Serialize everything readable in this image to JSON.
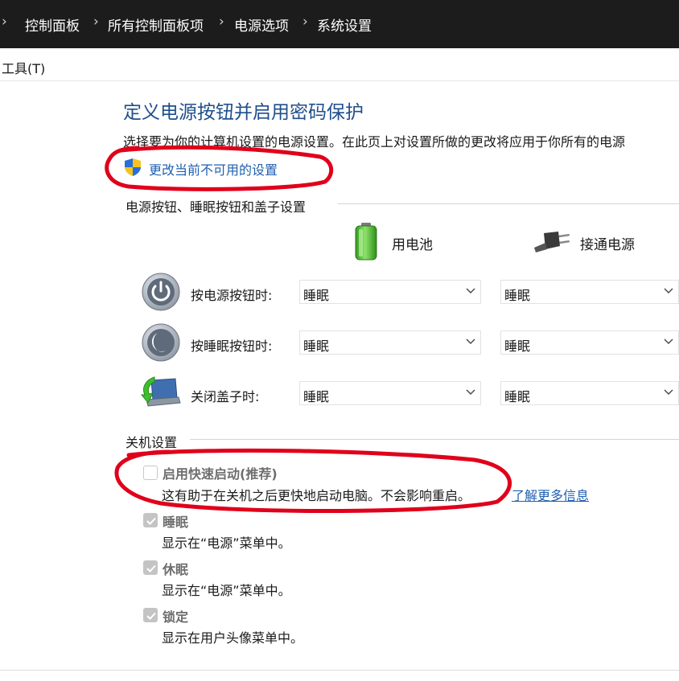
{
  "address_bar": {
    "crumbs": [
      "控制面板",
      "所有控制面板项",
      "电源选项",
      "系统设置"
    ]
  },
  "menu": {
    "tools": "工具(T)"
  },
  "page": {
    "title": "定义电源按钮并启用密码保护",
    "description": "选择要为你的计算机设置的电源设置。在此页上对设置所做的更改将应用于你所有的电源",
    "change_link": "更改当前不可用的设置"
  },
  "power_buttons": {
    "section_title": "电源按钮、睡眠按钮和盖子设置",
    "col_battery": "用电池",
    "col_plugged": "接通电源",
    "rows": [
      {
        "label": "按电源按钮时:",
        "battery": "睡眠",
        "plugged": "睡眠",
        "icon": "power-button-icon"
      },
      {
        "label": "按睡眠按钮时:",
        "battery": "睡眠",
        "plugged": "睡眠",
        "icon": "sleep-button-icon"
      },
      {
        "label": "关闭盖子时:",
        "battery": "睡眠",
        "plugged": "睡眠",
        "icon": "laptop-lid-icon"
      }
    ]
  },
  "shutdown": {
    "section_title": "关机设置",
    "fast_startup": {
      "label": "启用快速启动(推荐)",
      "desc": "这有助于在关机之后更快地启动电脑。不会影响重启。",
      "link": "了解更多信息",
      "checked": false
    },
    "sleep": {
      "label": "睡眠",
      "desc": "显示在“电源”菜单中。",
      "checked": true
    },
    "hibernate": {
      "label": "休眠",
      "desc": "显示在“电源”菜单中。",
      "checked": true
    },
    "lock": {
      "label": "锁定",
      "desc": "显示在用户头像菜单中。",
      "checked": true
    }
  },
  "colors": {
    "title_blue": "#1f4e8c",
    "link_blue": "#1f5fb0",
    "annotation_red": "#e0001b",
    "addressbar_bg": "#1c1c1c"
  }
}
